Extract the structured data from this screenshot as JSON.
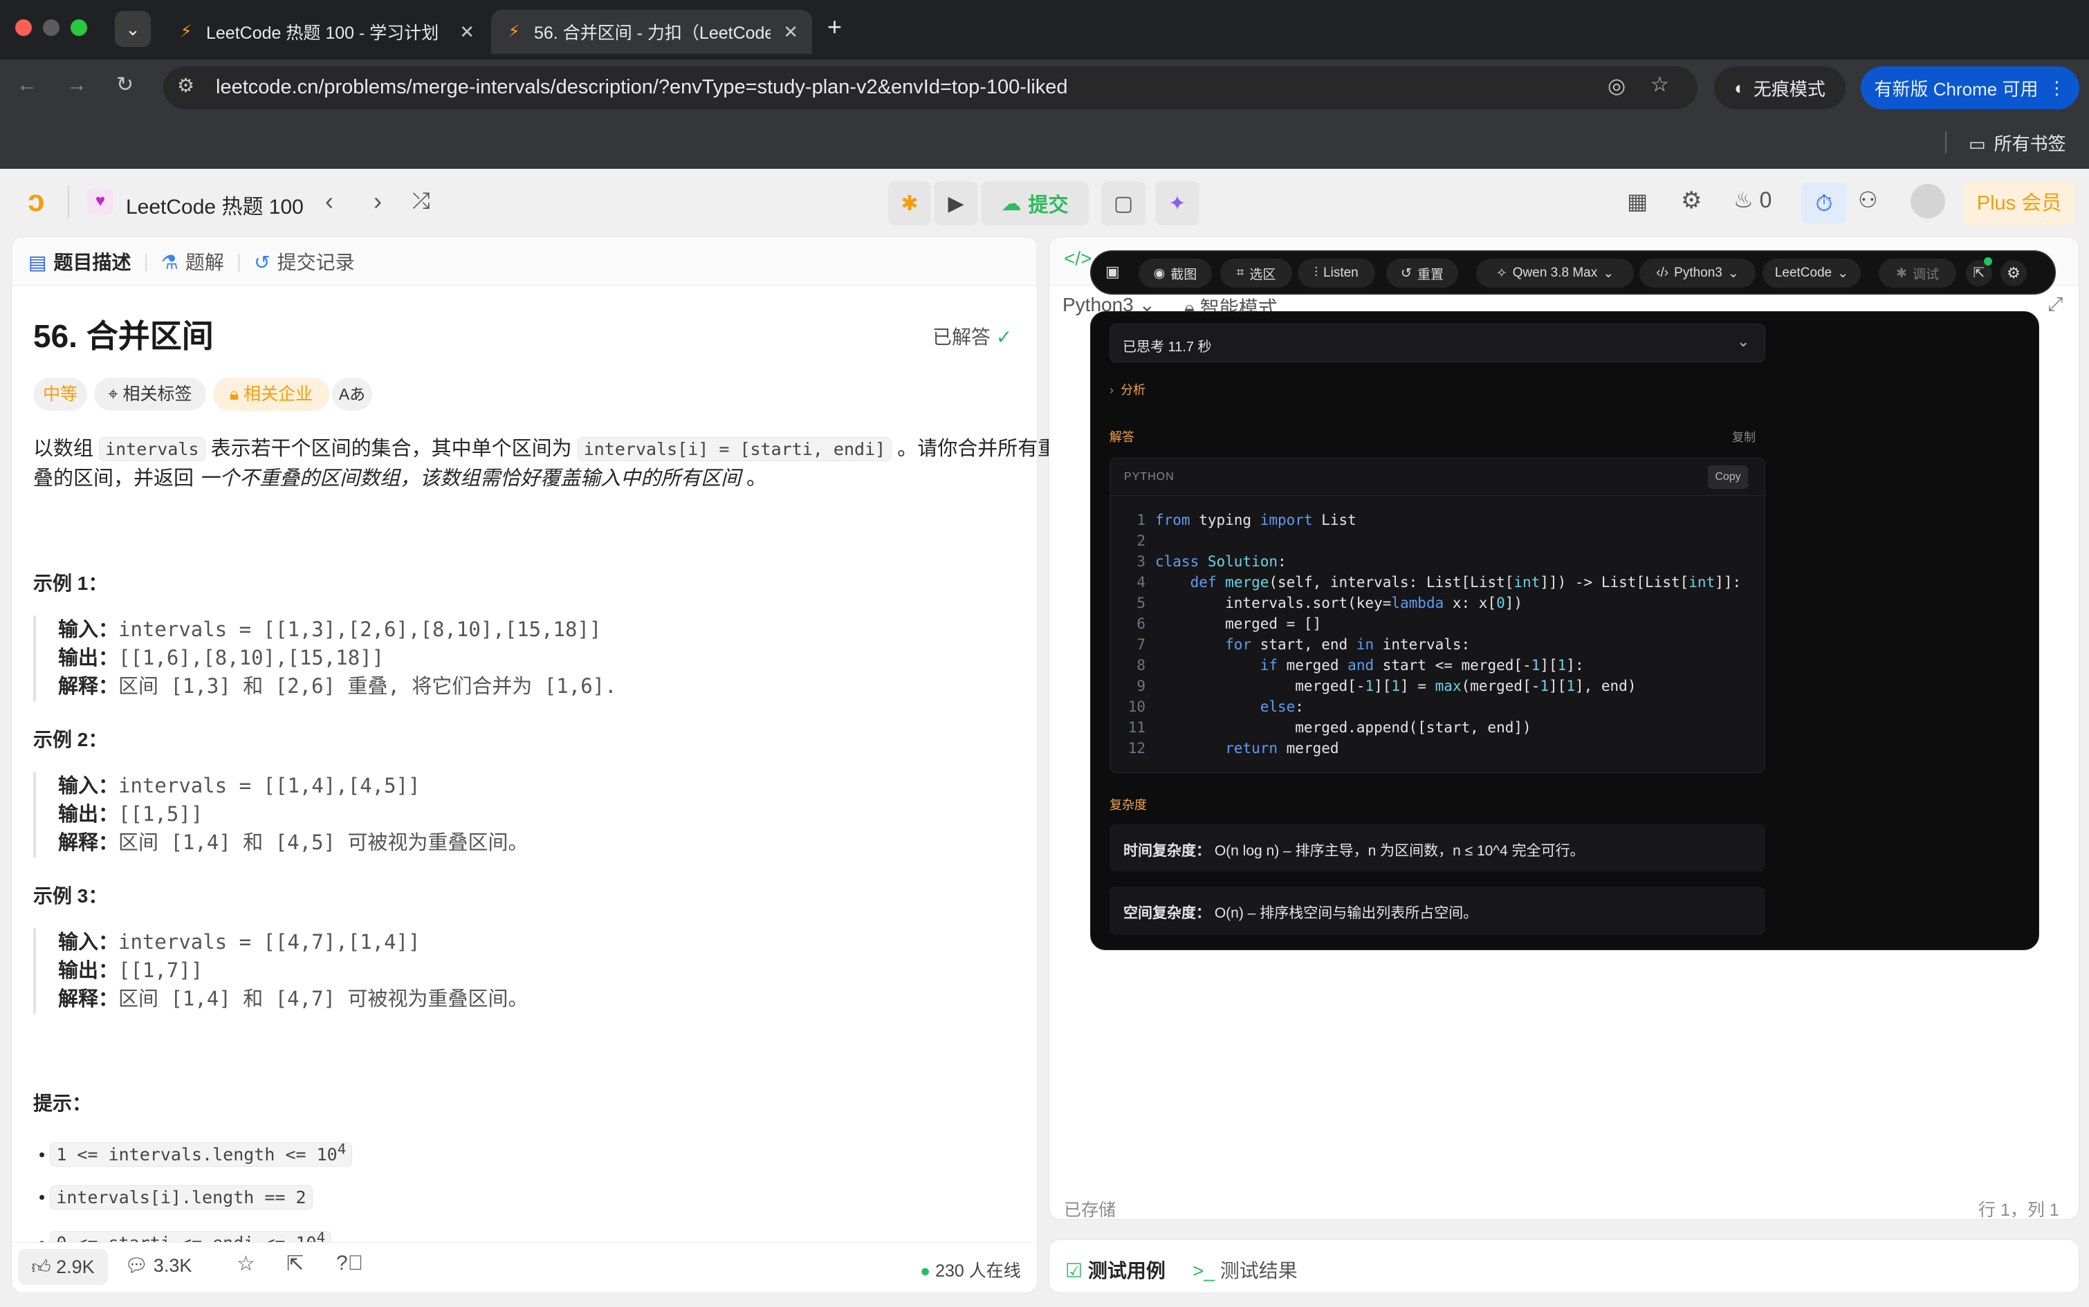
{
  "browser": {
    "tabs": [
      {
        "title": "LeetCode 热题 100 - 学习计划",
        "active": false
      },
      {
        "title": "56. 合并区间 - 力扣（LeetCode）",
        "active": true
      }
    ],
    "url": "leetcode.cn/problems/merge-intervals/description/?envType=study-plan-v2&envId=top-100-liked",
    "incognito_label": "无痕模式",
    "update_label": "有新版 Chrome 可用",
    "bookmarks_label": "所有书签"
  },
  "app": {
    "plan_title": "LeetCode 热题 100",
    "submit_label": "提交",
    "streak_count": "0",
    "plus_label": "Plus 会员"
  },
  "left": {
    "tabs": [
      "题目描述",
      "题解",
      "提交记录"
    ],
    "title": "56. 合并区间",
    "solved_label": "已解答",
    "tags": [
      "中等",
      "相关标签",
      "相关企业",
      "Aあ"
    ],
    "desc_part1": "以数组",
    "desc_code1": "intervals",
    "desc_part2": "表示若干个区间的集合，其中单个区间为",
    "desc_code2": "intervals[i] = [starti, endi]",
    "desc_part3": "。请你合并所有重",
    "desc_line2_a": "叠的区间，并返回",
    "desc_line2_b": "一个不重叠的区间数组，该数组需恰好覆盖输入中的所有区间",
    "desc_line2_c": "。",
    "examples": [
      {
        "heading": "示例 1：",
        "input_label": "输入：",
        "input": "intervals = [[1,3],[2,6],[8,10],[15,18]]",
        "output_label": "输出：",
        "output": "[[1,6],[8,10],[15,18]]",
        "explain_label": "解释：",
        "explain": "区间 [1,3] 和 [2,6] 重叠, 将它们合并为 [1,6]."
      },
      {
        "heading": "示例 2：",
        "input_label": "输入：",
        "input": "intervals = [[1,4],[4,5]]",
        "output_label": "输出：",
        "output": "[[1,5]]",
        "explain_label": "解释：",
        "explain": "区间 [1,4] 和 [4,5] 可被视为重叠区间。"
      },
      {
        "heading": "示例 3：",
        "input_label": "输入：",
        "input": "intervals = [[4,7],[1,4]]",
        "output_label": "输出：",
        "output": "[[1,7]]",
        "explain_label": "解释：",
        "explain": "区间 [1,4] 和 [4,7] 可被视为重叠区间。"
      }
    ],
    "hints_heading": "提示：",
    "hints": [
      "1 <= intervals.length <= 10",
      "intervals[i].length == 2",
      "0 <= starti <= endi <= 10"
    ],
    "footer": {
      "likes": "2.9K",
      "comments": "3.3K",
      "online": "230 人在线"
    }
  },
  "right": {
    "lang": "Python3",
    "mode": "智能模式",
    "saved": "已存储",
    "cursor": "行 1，列 1",
    "bottom_tabs": [
      "测试用例",
      "测试结果"
    ]
  },
  "overlay": {
    "toolbar": [
      "截图",
      "选区",
      "Listen",
      "重置",
      "Qwen 3.8 Max",
      "Python3",
      "LeetCode",
      "调试"
    ],
    "thought": "已思考 11.7 秒",
    "analysis": "分析",
    "answer_label": "解答",
    "copy_label": "复制",
    "code_lang": "PYTHON",
    "code_copy": "Copy",
    "complexity_label": "复杂度",
    "time_complexity_label": "时间复杂度：",
    "time_complexity": "O(n log n) – 排序主导，n 为区间数，n ≤ 10^4 完全可行。",
    "space_complexity_label": "空间复杂度：",
    "space_complexity": "O(n) – 排序栈空间与输出列表所占空间。"
  }
}
